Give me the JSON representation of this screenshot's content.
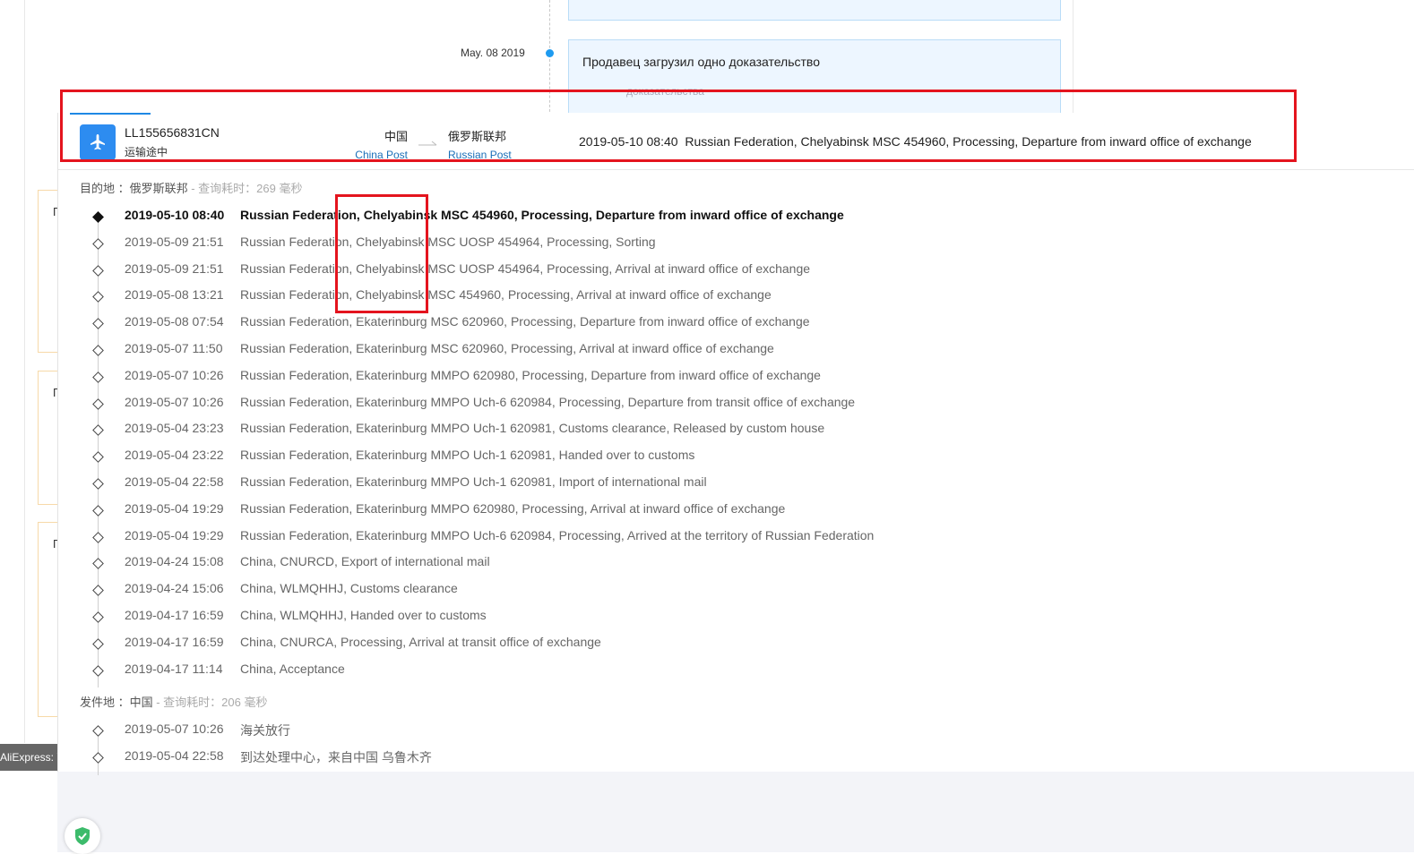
{
  "background": {
    "timeline_date": "May. 08 2019",
    "card_text": "Продавец загрузил одно доказательство",
    "card_subtext": "доказательства",
    "side_letters": [
      "П",
      "П",
      "П"
    ],
    "tab_label": "AliExpress: У"
  },
  "tracking": {
    "number": "LL155656831CN",
    "status": "运输途中",
    "origin_country": "中国",
    "origin_carrier": "China Post",
    "dest_country": "俄罗斯联邦",
    "dest_carrier": "Russian Post",
    "latest_time": "2019-05-10 08:40",
    "latest_desc": "Russian Federation, Chelyabinsk MSC 454960, Processing, Departure from inward office of exchange"
  },
  "destination": {
    "label": "目的地 ：俄罗斯联邦",
    "meta": " - 查询耗时：269 毫秒",
    "events": [
      {
        "time": "2019-05-10 08:40",
        "desc": "Russian Federation, Chelyabinsk MSC 454960, Processing, Departure from inward office of exchange"
      },
      {
        "time": "2019-05-09 21:51",
        "desc": "Russian Federation, Chelyabinsk MSC UOSP 454964, Processing, Sorting"
      },
      {
        "time": "2019-05-09 21:51",
        "desc": "Russian Federation, Chelyabinsk MSC UOSP 454964, Processing, Arrival at inward office of exchange"
      },
      {
        "time": "2019-05-08 13:21",
        "desc": "Russian Federation, Chelyabinsk MSC 454960, Processing, Arrival at inward office of exchange"
      },
      {
        "time": "2019-05-08 07:54",
        "desc": "Russian Federation, Ekaterinburg MSC 620960, Processing, Departure from inward office of exchange"
      },
      {
        "time": "2019-05-07 11:50",
        "desc": "Russian Federation, Ekaterinburg MSC 620960, Processing, Arrival at inward office of exchange"
      },
      {
        "time": "2019-05-07 10:26",
        "desc": "Russian Federation, Ekaterinburg MMPO 620980, Processing, Departure from inward office of exchange"
      },
      {
        "time": "2019-05-07 10:26",
        "desc": "Russian Federation, Ekaterinburg MMPO Uch-6 620984, Processing, Departure from transit office of exchange"
      },
      {
        "time": "2019-05-04 23:23",
        "desc": "Russian Federation, Ekaterinburg MMPO Uch-1 620981, Customs clearance, Released by custom house"
      },
      {
        "time": "2019-05-04 23:22",
        "desc": "Russian Federation, Ekaterinburg MMPO Uch-1 620981, Handed over to customs"
      },
      {
        "time": "2019-05-04 22:58",
        "desc": "Russian Federation, Ekaterinburg MMPO Uch-1 620981, Import of international mail"
      },
      {
        "time": "2019-05-04 19:29",
        "desc": "Russian Federation, Ekaterinburg MMPO 620980, Processing, Arrival at inward office of exchange"
      },
      {
        "time": "2019-05-04 19:29",
        "desc": "Russian Federation, Ekaterinburg MMPO Uch-6 620984, Processing, Arrived at the territory of Russian Federation"
      },
      {
        "time": "2019-04-24 15:08",
        "desc": "China, CNURCD, Export of international mail"
      },
      {
        "time": "2019-04-24 15:06",
        "desc": "China, WLMQHHJ, Customs clearance"
      },
      {
        "time": "2019-04-17 16:59",
        "desc": "China, WLMQHHJ, Handed over to customs"
      },
      {
        "time": "2019-04-17 16:59",
        "desc": "China, CNURCA, Processing, Arrival at transit office of exchange"
      },
      {
        "time": "2019-04-17 11:14",
        "desc": "China, Acceptance"
      }
    ]
  },
  "origin_section": {
    "label": "发件地 ：中国",
    "meta": " - 查询耗时：206 毫秒",
    "events": [
      {
        "time": "2019-05-07 10:26",
        "desc": "海关放行"
      },
      {
        "time": "2019-05-04 22:58",
        "desc": "到达处理中心，来自中国 乌鲁木齐"
      }
    ]
  },
  "colors": {
    "accent": "#2d8cf0",
    "highlight": "#e4141e",
    "carrier_link": "#1a6fb8"
  }
}
